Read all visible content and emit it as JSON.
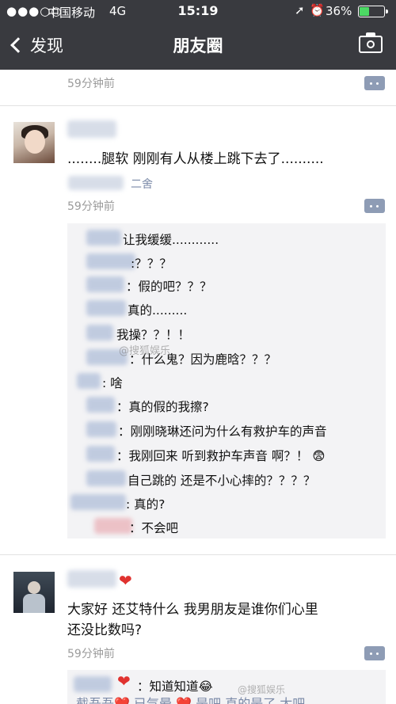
{
  "status_bar": {
    "signal": "●●●○○",
    "carrier": "中国移动",
    "network": "4G",
    "time": "15:19",
    "battery": "36%",
    "battery_fraction": 0.36,
    "icons": [
      "location-arrow-icon",
      "alarm-icon",
      "battery-icon"
    ]
  },
  "nav": {
    "back_label": "发现",
    "title": "朋友圈",
    "camera_icon": "camera-icon"
  },
  "feed": {
    "prev_post_time": "59分钟前",
    "post1": {
      "text": "........腿软 刚刚有人从楼上跳下去了..........",
      "location": "二舍",
      "time": "59分钟前",
      "comments": [
        "让我缓缓............",
        ":？？？",
        "：假的吧？？？",
        "真的.........",
        "我操？？！！",
        "：什么鬼？因为鹿晗？？？",
        ": 啥",
        "：真的假的我擦?",
        "：刚刚晓琳还问为什么有救护车的声音",
        "：我刚回来 听到救护车声音 啊？！ 😨",
        "自己跳的 还是不小心摔的？？？？",
        ": 真的?",
        "：不会吧"
      ],
      "watermark": "@搜狐娱乐"
    },
    "post2": {
      "text_line1": "大家好 还艾特什么 我男朋友是谁你们心里",
      "text_line2": "还没比数吗?",
      "time": "59分钟前",
      "comments": [
        "：知道知道😂"
      ],
      "watermark": "@搜狐娱乐",
      "cut_text": "截吾吾❤️ 已气晕   ❤️   是吧  直的是了 太吧"
    }
  },
  "colors": {
    "topbar": "#393a3f",
    "link_blue": "#7b8aa8",
    "comment_bg": "#f3f3f5",
    "time_grey": "#9b9b9b",
    "heart_red": "#e0322f",
    "battery_green": "#4cd964"
  }
}
